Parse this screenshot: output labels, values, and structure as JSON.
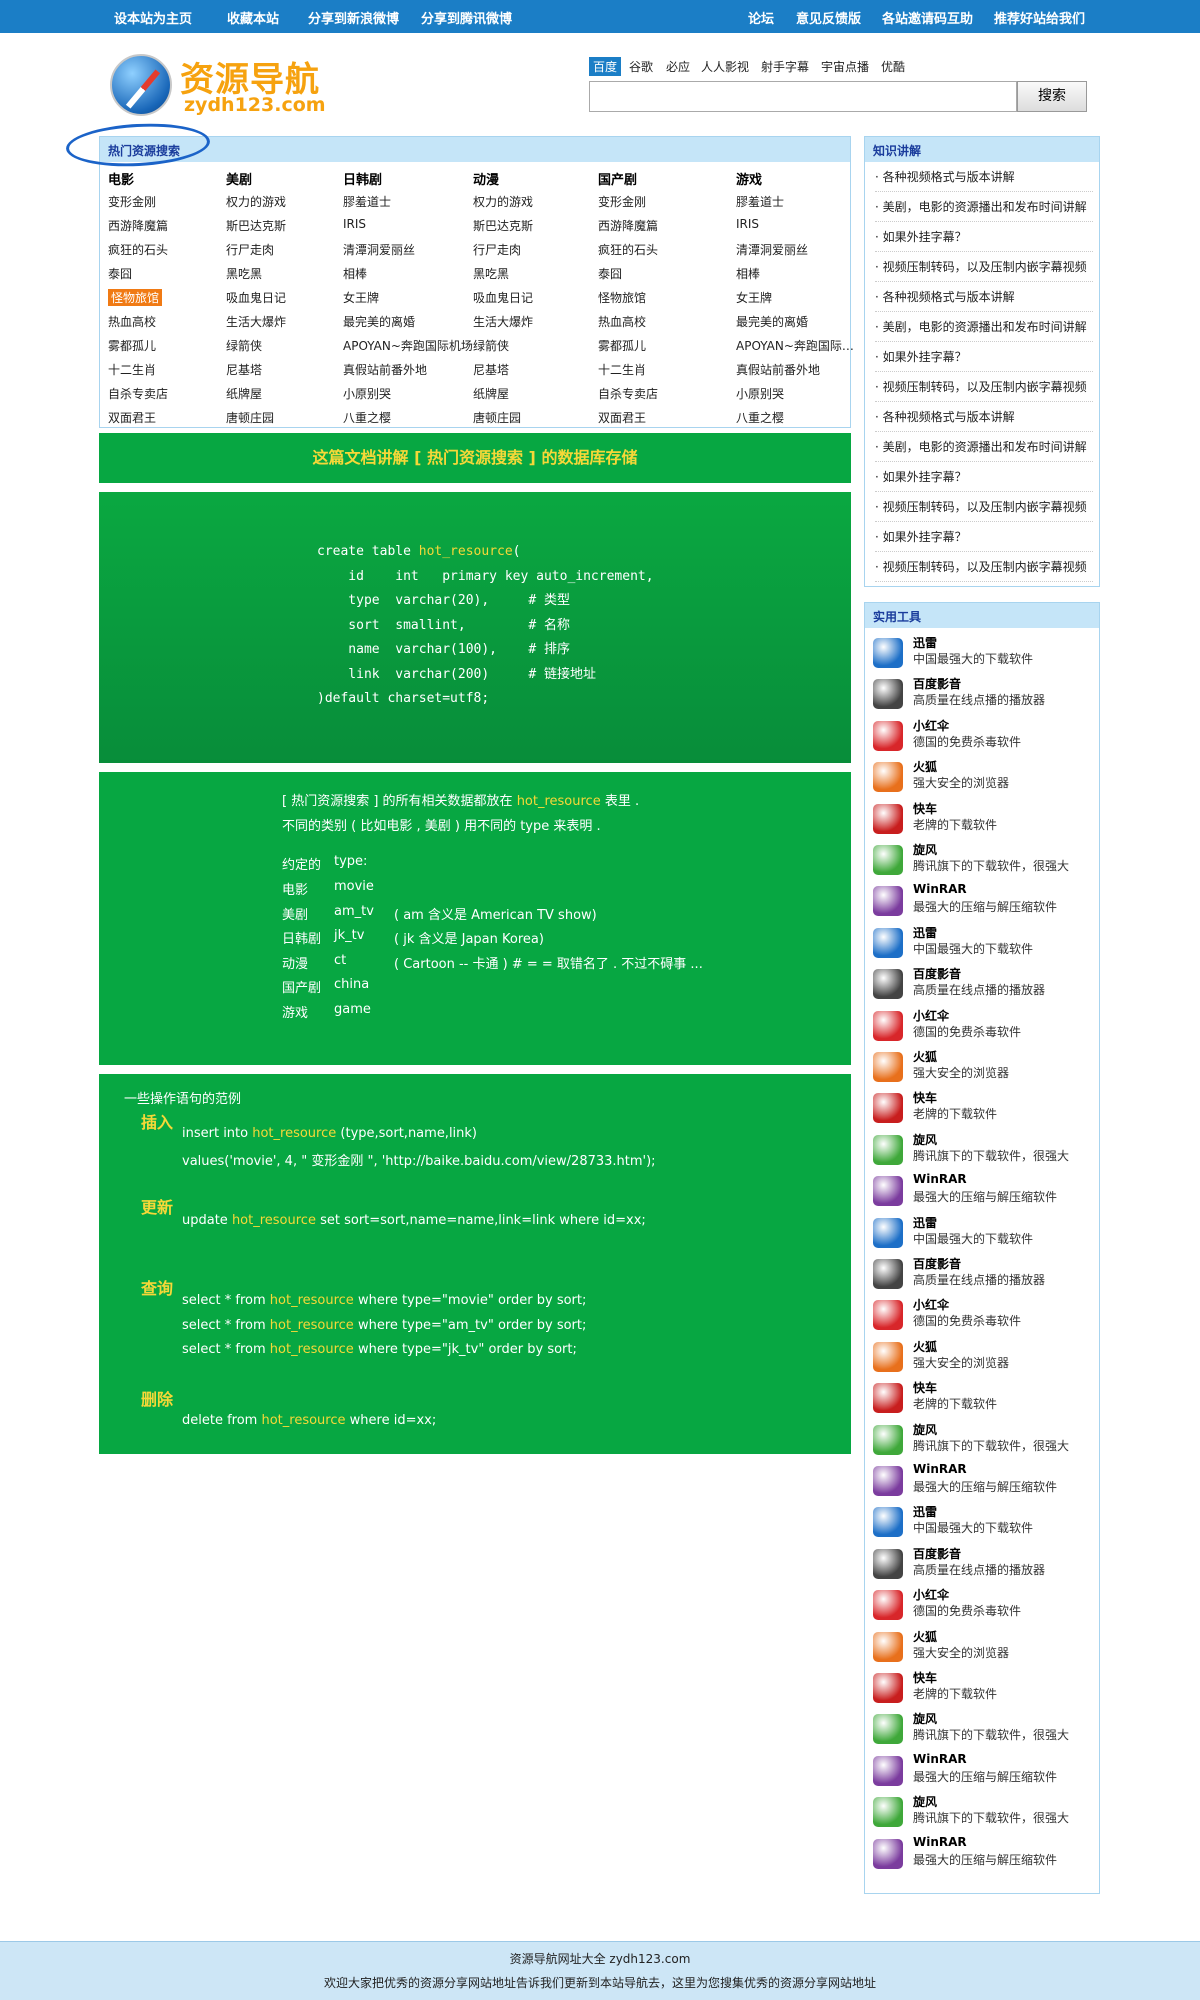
{
  "topbar": {
    "left": [
      "设本站为主页",
      "收藏本站",
      "分享到新浪微博",
      "分享到腾讯微博"
    ],
    "right": [
      "论坛",
      "意见反馈版",
      "各站邀请码互助",
      "推荐好站给我们"
    ]
  },
  "logo": {
    "title": "资源导航",
    "subtitle": "zydh123.com"
  },
  "search": {
    "engines": [
      "百度",
      "谷歌",
      "必应",
      "人人影视",
      "射手字幕",
      "宇宙点播",
      "优酷"
    ],
    "active_engine": "百度",
    "value": "",
    "button": "搜索"
  },
  "hot": {
    "title": "热门资源搜索",
    "columns": [
      {
        "header": "电影",
        "items": [
          "变形金刚",
          "西游降魔篇",
          "疯狂的石头",
          "泰囧",
          "怪物旅馆",
          "热血高校",
          "雾都孤儿",
          "十二生肖",
          "自杀专卖店",
          "双面君王"
        ]
      },
      {
        "header": "美剧",
        "items": [
          "权力的游戏",
          "斯巴达克斯",
          "行尸走肉",
          "黑吃黑",
          "吸血鬼日记",
          "生活大爆炸",
          "绿箭侠",
          "尼基塔",
          "纸牌屋",
          "唐顿庄园"
        ]
      },
      {
        "header": "日韩剧",
        "items": [
          "膠羞道士",
          "IRIS",
          "清潭洞爱丽丝",
          "相棒",
          "女王牌",
          "最完美的离婚",
          "APOYAN~奔跑国际机场",
          "真假站前番外地",
          "小原别哭",
          "八重之樱"
        ]
      },
      {
        "header": "动漫",
        "items": [
          "权力的游戏",
          "斯巴达克斯",
          "行尸走肉",
          "黑吃黑",
          "吸血鬼日记",
          "生活大爆炸",
          "绿箭侠",
          "尼基塔",
          "纸牌屋",
          "唐顿庄园"
        ]
      },
      {
        "header": "国产剧",
        "items": [
          "变形金刚",
          "西游降魔篇",
          "疯狂的石头",
          "泰囧",
          "怪物旅馆",
          "热血高校",
          "雾都孤儿",
          "十二生肖",
          "自杀专卖店",
          "双面君王"
        ]
      },
      {
        "header": "游戏",
        "items": [
          "膠羞道士",
          "IRIS",
          "清潭洞爱丽丝",
          "相棒",
          "女王牌",
          "最完美的离婚",
          "APOYAN~奔跑国际…",
          "真假站前番外地",
          "小原别哭",
          "八重之樱"
        ]
      }
    ],
    "highlight_color": "#f07a14"
  },
  "doc": {
    "banner": "这篇文档讲解 [ 热门资源搜索 ] 的数据库存储",
    "sql": {
      "create": "create table ",
      "table": "hot_resource",
      "open": "(",
      "rows": [
        "    id    int   primary key auto_increment,",
        "    type  varchar(20),     # 类型",
        "    sort  smallint,        # 名称",
        "    name  varchar(100),    # 排序",
        "    link  varchar(200)     # 链接地址"
      ],
      "close": ")default charset=utf8;"
    },
    "desc": {
      "line1_a": "[ 热门资源搜索 ] 的所有相关数据都放在 ",
      "line1_b": "hot_resource",
      "line1_c": " 表里 .",
      "line2": "不同的类别 ( 比如电影 , 美剧 ) 用不同的 type 来表明 .",
      "conv_label": "约定的",
      "conv_value": "type:",
      "types": [
        {
          "name": "电影",
          "code": "movie",
          "note": ""
        },
        {
          "name": "美剧",
          "code": "am_tv",
          "note": "( am 含义是 American TV show)"
        },
        {
          "name": "日韩剧",
          "code": "jk_tv",
          "note": "( jk 含义是 Japan Korea)"
        },
        {
          "name": "动漫",
          "code": "ct",
          "note": "( Cartoon -- 卡通 )    # = = 取错名了 . 不过不碍事 ..."
        },
        {
          "name": "国产剧",
          "code": "china",
          "note": ""
        },
        {
          "name": "游戏",
          "code": "game",
          "note": ""
        }
      ]
    },
    "ops": {
      "title": "一些操作语句的范例",
      "insert_h": "插入",
      "insert_1a": "insert into ",
      "insert_1b": "hot_resource",
      "insert_1c": " (type,sort,name,link)",
      "insert_2": "values('movie', 4, \" 变形金刚 \", 'http://baike.baidu.com/view/28733.htm');",
      "update_h": "更新",
      "update_a": "update  ",
      "update_b": "hot_resource",
      "update_c": "  set  sort=sort,name=name,link=link where id=xx;",
      "query_h": "查询",
      "q1a": "select * from  ",
      "q1b": "hot_resource",
      "q1c": "  where type=\"movie\" order by sort;",
      "q2a": "select * from  ",
      "q2b": "hot_resource",
      "q2c": "  where type=\"am_tv\" order by sort;",
      "q3a": "select * from  ",
      "q3b": "hot_resource",
      "q3c": "  where type=\"jk_tv\" order by sort;",
      "delete_h": "删除",
      "del_a": "delete from ",
      "del_b": "hot_resource",
      "del_c": " where id=xx;"
    }
  },
  "knowledge": {
    "title": "知识讲解",
    "items": [
      "· 各种视频格式与版本讲解",
      "· 美剧，电影的资源播出和发布时间讲解",
      "· 如果外挂字幕？",
      "· 视频压制转码，以及压制内嵌字幕视频",
      "· 各种视频格式与版本讲解",
      "· 美剧，电影的资源播出和发布时间讲解",
      "· 如果外挂字幕？",
      "· 视频压制转码，以及压制内嵌字幕视频",
      "· 各种视频格式与版本讲解",
      "· 美剧，电影的资源播出和发布时间讲解",
      "· 如果外挂字幕？",
      "· 视频压制转码，以及压制内嵌字幕视频",
      "· 如果外挂字幕？",
      "· 视频压制转码，以及压制内嵌字幕视频"
    ]
  },
  "tools": {
    "title": "实用工具",
    "items": [
      {
        "name": "迅雷",
        "desc": "中国最强大的下载软件",
        "icon": "thunder-icon",
        "color": "#1d6fc7"
      },
      {
        "name": "百度影音",
        "desc": "高质量在线点播的播放器",
        "icon": "film-reel-icon",
        "color": "#444444"
      },
      {
        "name": "小红伞",
        "desc": "德国的免费杀毒软件",
        "icon": "umbrella-icon",
        "color": "#d8262a"
      },
      {
        "name": "火狐",
        "desc": "强大安全的浏览器",
        "icon": "firefox-icon",
        "color": "#e8701c"
      },
      {
        "name": "快车",
        "desc": "老牌的下载软件",
        "icon": "flashget-icon",
        "color": "#c81e1e"
      },
      {
        "name": "旋风",
        "desc": "腾讯旗下的下载软件，很强大",
        "icon": "whirlwind-icon",
        "color": "#3fa83a"
      },
      {
        "name": "WinRAR",
        "desc": "最强大的压缩与解压缩软件",
        "icon": "winrar-icon",
        "color": "#7b3c9e"
      },
      {
        "name": "迅雷",
        "desc": "中国最强大的下载软件",
        "icon": "thunder-icon",
        "color": "#1d6fc7"
      },
      {
        "name": "百度影音",
        "desc": "高质量在线点播的播放器",
        "icon": "film-reel-icon",
        "color": "#444444"
      },
      {
        "name": "小红伞",
        "desc": "德国的免费杀毒软件",
        "icon": "umbrella-icon",
        "color": "#d8262a"
      },
      {
        "name": "火狐",
        "desc": "强大安全的浏览器",
        "icon": "firefox-icon",
        "color": "#e8701c"
      },
      {
        "name": "快车",
        "desc": "老牌的下载软件",
        "icon": "flashget-icon",
        "color": "#c81e1e"
      },
      {
        "name": "旋风",
        "desc": "腾讯旗下的下载软件，很强大",
        "icon": "whirlwind-icon",
        "color": "#3fa83a"
      },
      {
        "name": "WinRAR",
        "desc": "最强大的压缩与解压缩软件",
        "icon": "winrar-icon",
        "color": "#7b3c9e"
      },
      {
        "name": "迅雷",
        "desc": "中国最强大的下载软件",
        "icon": "thunder-icon",
        "color": "#1d6fc7"
      },
      {
        "name": "百度影音",
        "desc": "高质量在线点播的播放器",
        "icon": "film-reel-icon",
        "color": "#444444"
      },
      {
        "name": "小红伞",
        "desc": "德国的免费杀毒软件",
        "icon": "umbrella-icon",
        "color": "#d8262a"
      },
      {
        "name": "火狐",
        "desc": "强大安全的浏览器",
        "icon": "firefox-icon",
        "color": "#e8701c"
      },
      {
        "name": "快车",
        "desc": "老牌的下载软件",
        "icon": "flashget-icon",
        "color": "#c81e1e"
      },
      {
        "name": "旋风",
        "desc": "腾讯旗下的下载软件，很强大",
        "icon": "whirlwind-icon",
        "color": "#3fa83a"
      },
      {
        "name": "WinRAR",
        "desc": "最强大的压缩与解压缩软件",
        "icon": "winrar-icon",
        "color": "#7b3c9e"
      },
      {
        "name": "迅雷",
        "desc": "中国最强大的下载软件",
        "icon": "thunder-icon",
        "color": "#1d6fc7"
      },
      {
        "name": "百度影音",
        "desc": "高质量在线点播的播放器",
        "icon": "film-reel-icon",
        "color": "#444444"
      },
      {
        "name": "小红伞",
        "desc": "德国的免费杀毒软件",
        "icon": "umbrella-icon",
        "color": "#d8262a"
      },
      {
        "name": "火狐",
        "desc": "强大安全的浏览器",
        "icon": "firefox-icon",
        "color": "#e8701c"
      },
      {
        "name": "快车",
        "desc": "老牌的下载软件",
        "icon": "flashget-icon",
        "color": "#c81e1e"
      },
      {
        "name": "旋风",
        "desc": "腾讯旗下的下载软件，很强大",
        "icon": "whirlwind-icon",
        "color": "#3fa83a"
      },
      {
        "name": "WinRAR",
        "desc": "最强大的压缩与解压缩软件",
        "icon": "winrar-icon",
        "color": "#7b3c9e"
      },
      {
        "name": "旋风",
        "desc": "腾讯旗下的下载软件，很强大",
        "icon": "whirlwind-icon",
        "color": "#3fa83a"
      },
      {
        "name": "WinRAR",
        "desc": "最强大的压缩与解压缩软件",
        "icon": "winrar-icon",
        "color": "#7b3c9e"
      }
    ]
  },
  "footer": {
    "line1": "资源导航网址大全 zydh123.com",
    "line2": "欢迎大家把优秀的资源分享网站地址告诉我们更新到本站导航去，这里为您搜集优秀的资源分享网站地址"
  },
  "colors": {
    "topbar": "#1b7ec6",
    "green": "#07a742",
    "accent_yellow": "#f6d838",
    "panel_head": "#c5e5f8"
  }
}
